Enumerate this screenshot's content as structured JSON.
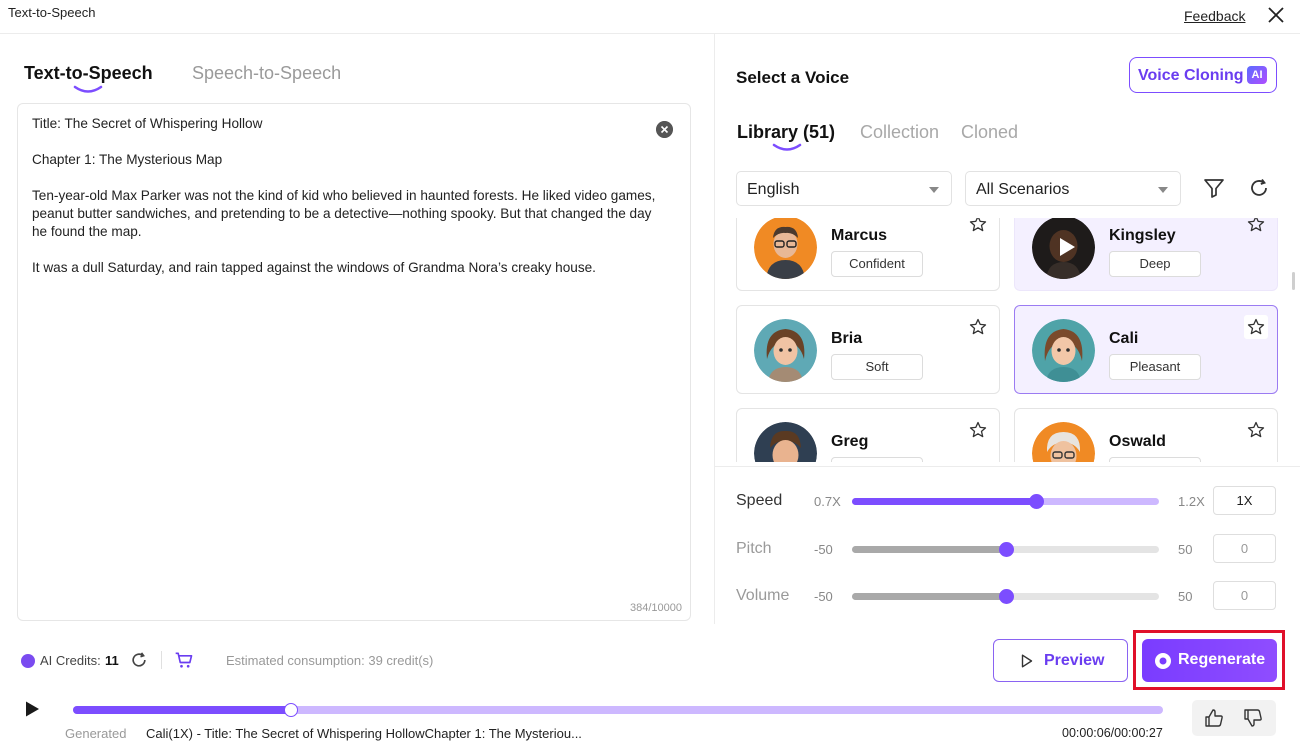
{
  "window": {
    "title": "Text-to-Speech",
    "feedback_label": "Feedback"
  },
  "left_tabs": [
    {
      "label": "Text-to-Speech"
    },
    {
      "label": "Speech-to-Speech"
    }
  ],
  "editor": {
    "lines": [
      "Title: The Secret of Whispering Hollow",
      "Chapter 1: The Mysterious Map",
      "Ten-year-old Max Parker was not the kind of kid who believed in haunted forests. He liked video games,",
      "peanut butter sandwiches, and pretending to be a detective—nothing spooky. But that changed the day",
      "he found the map.",
      "It was a dull Saturday, and rain tapped against the windows of Grandma Nora’s creaky house."
    ],
    "char_count": "384/10000"
  },
  "voice_panel": {
    "title": "Select a Voice",
    "voice_cloning_label": "Voice Cloning",
    "ai_badge": "AI",
    "tabs": [
      {
        "label": "Library (51)"
      },
      {
        "label": "Collection"
      },
      {
        "label": "Cloned"
      }
    ],
    "language": "English",
    "scenario": "All Scenarios",
    "voices": [
      {
        "name": "Marcus",
        "tag": "Confident"
      },
      {
        "name": "Kingsley",
        "tag": "Deep"
      },
      {
        "name": "Bria",
        "tag": "Soft"
      },
      {
        "name": "Cali",
        "tag": "Pleasant"
      },
      {
        "name": "Greg",
        "tag": ""
      },
      {
        "name": "Oswald",
        "tag": ""
      }
    ],
    "selected_voice": "Cali"
  },
  "sliders": [
    {
      "label": "Speed",
      "min": "0.7X",
      "max": "1.2X",
      "value": "1X",
      "fraction": 0.6
    },
    {
      "label": "Pitch",
      "min": "-50",
      "max": "50",
      "value": "0",
      "fraction": 0.5
    },
    {
      "label": "Volume",
      "min": "-50",
      "max": "50",
      "value": "0",
      "fraction": 0.5
    }
  ],
  "footer": {
    "credits_label": "AI Credits:",
    "credits_value": "11",
    "estimate": "Estimated consumption: 39 credit(s)",
    "preview_label": "Preview",
    "regenerate_label": "Regenerate"
  },
  "player": {
    "progress": 0.2,
    "generated_label": "Generated",
    "track_title": "Cali(1X) - Title: The Secret of Whispering HollowChapter 1: The Mysteriou...",
    "time": "00:00:06/00:00:27"
  },
  "colors": {
    "accent": "#7c4dff",
    "highlight": "#e0102a"
  }
}
